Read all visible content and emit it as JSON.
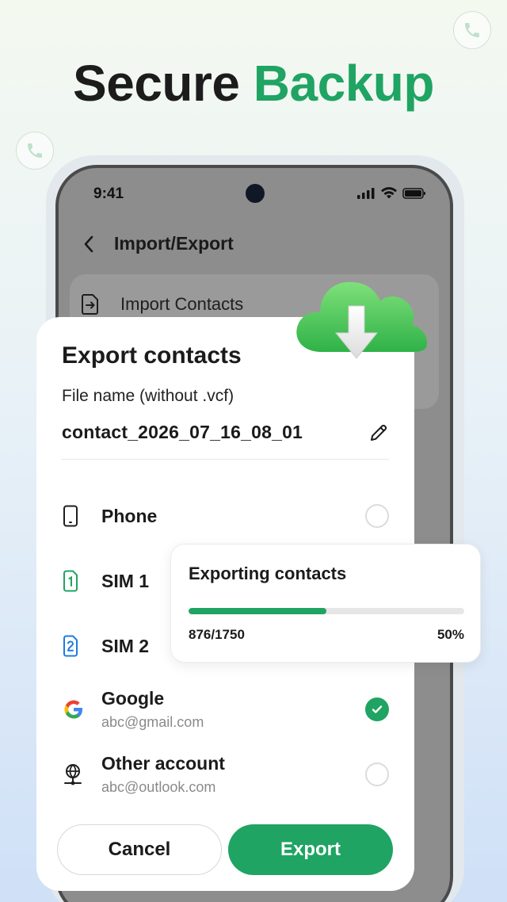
{
  "headline": {
    "word1": "Secure",
    "word2": "Backup"
  },
  "colors": {
    "accent": "#1fa463",
    "text": "#1c1c1c"
  },
  "icons": {
    "float": "phone-icon",
    "cloud": "cloud-download-icon"
  },
  "status_bar": {
    "time": "9:41"
  },
  "screen": {
    "title": "Import/Export",
    "back_icon": "chevron-left-icon",
    "items": [
      {
        "label": "Import Contacts",
        "icon": "import-file-icon"
      }
    ]
  },
  "dialog": {
    "title": "Export contacts",
    "file_label": "File name (without .vcf)",
    "file_name": "contact_2026_07_16_08_01",
    "options": [
      {
        "name": "Phone",
        "sub": "",
        "icon": "phone-device-icon",
        "checked": false
      },
      {
        "name": "SIM 1",
        "sub": "",
        "icon": "sim-1-icon",
        "checked": false
      },
      {
        "name": "SIM 2",
        "sub": "",
        "icon": "sim-2-icon",
        "checked": false
      },
      {
        "name": "Google",
        "sub": "abc@gmail.com",
        "icon": "google-icon",
        "checked": true
      },
      {
        "name": "Other account",
        "sub": "abc@outlook.com",
        "icon": "globe-account-icon",
        "checked": false
      }
    ],
    "cancel_label": "Cancel",
    "export_label": "Export"
  },
  "progress": {
    "title": "Exporting contacts",
    "count_text": "876/1750",
    "percent_text": "50%",
    "fraction": 0.5
  }
}
